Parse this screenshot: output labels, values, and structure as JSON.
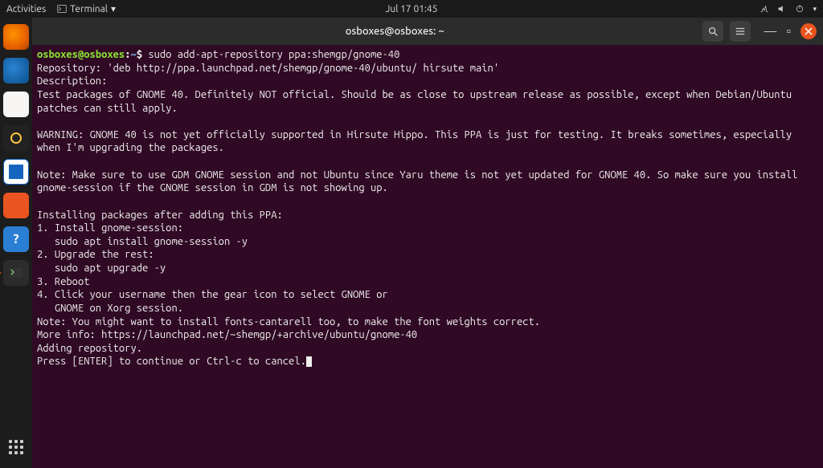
{
  "topbar": {
    "activities": "Activities",
    "app_indicator": "Terminal",
    "clock": "Jul 17  01:45"
  },
  "dock": {
    "tooltip": "Firefox Web Browser",
    "items": [
      {
        "name": "firefox-icon"
      },
      {
        "name": "thunderbird-icon"
      },
      {
        "name": "files-icon"
      },
      {
        "name": "rhythmbox-icon"
      },
      {
        "name": "libreoffice-writer-icon"
      },
      {
        "name": "software-icon"
      },
      {
        "name": "help-icon"
      },
      {
        "name": "terminal-icon"
      }
    ]
  },
  "window": {
    "title": "osboxes@osboxes: ~"
  },
  "terminal": {
    "prompt_user_host": "osboxes@osboxes",
    "prompt_path": "~",
    "prompt_symbol": "$",
    "command": "sudo add-apt-repository ppa:shemgp/gnome-40",
    "lines": [
      "Repository: 'deb http://ppa.launchpad.net/shemgp/gnome-40/ubuntu/ hirsute main'",
      "Description:",
      "Test packages of GNOME 40. Definitely NOT official. Should be as close to upstream release as possible, except when Debian/Ubuntu patches can still apply.",
      "",
      "WARNING: GNOME 40 is not yet officially supported in Hirsute Hippo. This PPA is just for testing. It breaks sometimes, especially when I'm upgrading the packages.",
      "",
      "Note: Make sure to use GDM GNOME session and not Ubuntu since Yaru theme is not yet updated for GNOME 40. So make sure you install gnome-session if the GNOME session in GDM is not showing up.",
      "",
      "Installing packages after adding this PPA:",
      "1. Install gnome-session:",
      "   sudo apt install gnome-session -y",
      "2. Upgrade the rest:",
      "   sudo apt upgrade -y",
      "3. Reboot",
      "4. Click your username then the gear icon to select GNOME or",
      "   GNOME on Xorg session.",
      "Note: You might want to install fonts-cantarell too, to make the font weights correct.",
      "More info: https://launchpad.net/~shemgp/+archive/ubuntu/gnome-40",
      "Adding repository.",
      "Press [ENTER] to continue or Ctrl-c to cancel."
    ]
  }
}
